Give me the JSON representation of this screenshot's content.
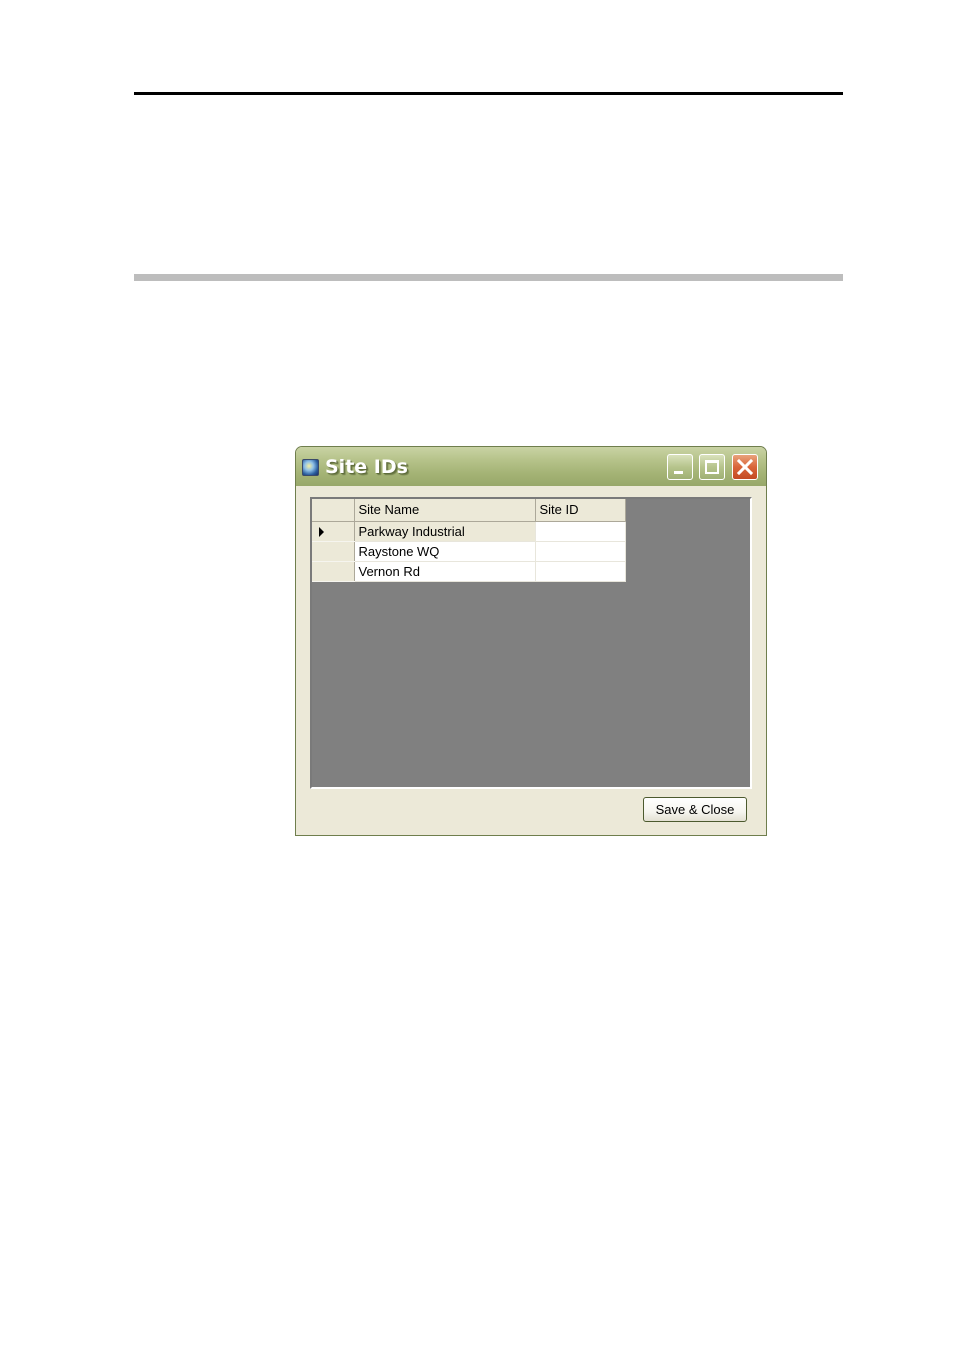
{
  "window": {
    "title": "Site IDs",
    "icon": "globe-app-icon",
    "controls": {
      "minimize": "minimize-icon",
      "maximize": "maximize-icon",
      "close": "close-icon"
    }
  },
  "grid": {
    "columns": [
      "Site Name",
      "Site ID"
    ],
    "current_row": 0,
    "rows": [
      {
        "site_name": "Parkway Industrial",
        "site_id": ""
      },
      {
        "site_name": "Raystone WQ",
        "site_id": ""
      },
      {
        "site_name": "Vernon Rd",
        "site_id": ""
      }
    ]
  },
  "footer": {
    "save_label": "Save & Close"
  },
  "colors": {
    "titlebar": "#a3b274",
    "close_button": "#d9653a",
    "dialog_face": "#ece9d8",
    "grid_background": "#808080"
  }
}
